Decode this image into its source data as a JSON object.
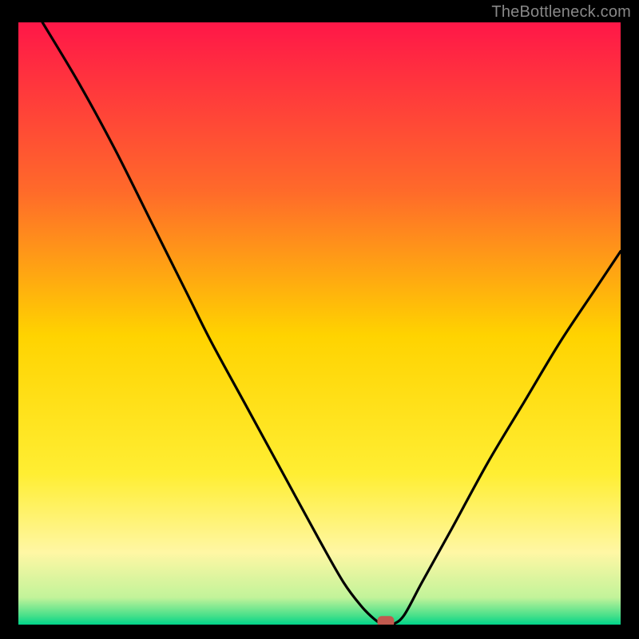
{
  "watermark": "TheBottleneck.com",
  "chart_data": {
    "type": "line",
    "title": "",
    "xlabel": "",
    "ylabel": "",
    "xlim": [
      0,
      100
    ],
    "ylim": [
      0,
      100
    ],
    "grid": false,
    "background": "rainbow-gradient",
    "gradient_stops": [
      {
        "offset": 0.0,
        "color": "#ff1748"
      },
      {
        "offset": 0.28,
        "color": "#ff6a2a"
      },
      {
        "offset": 0.52,
        "color": "#ffd300"
      },
      {
        "offset": 0.75,
        "color": "#ffee33"
      },
      {
        "offset": 0.88,
        "color": "#fff7a4"
      },
      {
        "offset": 0.955,
        "color": "#c2f39a"
      },
      {
        "offset": 0.985,
        "color": "#48e08a"
      },
      {
        "offset": 1.0,
        "color": "#00d58a"
      }
    ],
    "series": [
      {
        "name": "bottleneck-curve",
        "x": [
          4,
          10,
          16,
          22,
          28,
          32,
          38,
          44,
          50,
          54,
          57,
          59,
          60.5,
          62,
          64,
          67,
          72,
          78,
          84,
          90,
          96,
          100
        ],
        "y": [
          100,
          90,
          79,
          67,
          55,
          47,
          36,
          25,
          14,
          7,
          3,
          1,
          0,
          0,
          1.5,
          7,
          16,
          27,
          37,
          47,
          56,
          62
        ]
      }
    ],
    "marker": {
      "x": 61,
      "y": 0.5,
      "shape": "rounded-rect",
      "color": "#c25a4f"
    }
  }
}
